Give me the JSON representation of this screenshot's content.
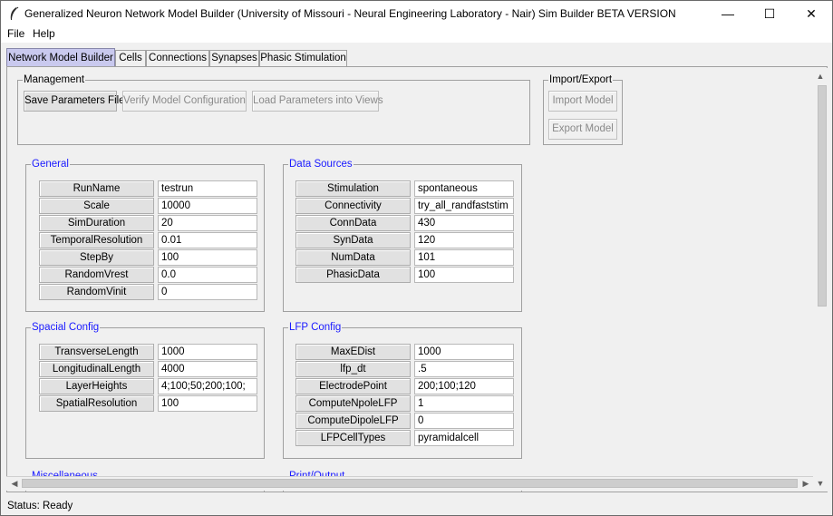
{
  "window": {
    "title": "Generalized Neuron Network Model Builder (University of Missouri - Neural Engineering Laboratory - Nair) Sim Builder BETA VERSION",
    "minimize": "—",
    "maximize": "☐",
    "close": "✕"
  },
  "menu": {
    "file": "File",
    "help": "Help"
  },
  "tabs": [
    "Network Model Builder",
    "Cells",
    "Connections",
    "Synapses",
    "Phasic Stimulation"
  ],
  "management": {
    "label": "Management",
    "save": "Save Parameters File",
    "verify": "Verify Model Configuration",
    "load": "Load Parameters into Views"
  },
  "import_export": {
    "label": "Import/Export",
    "import": "Import Model",
    "export": "Export Model"
  },
  "general": {
    "label": "General",
    "rows": [
      {
        "name": "RunName",
        "value": "testrun"
      },
      {
        "name": "Scale",
        "value": "10000"
      },
      {
        "name": "SimDuration",
        "value": "20"
      },
      {
        "name": "TemporalResolution",
        "value": "0.01"
      },
      {
        "name": "StepBy",
        "value": "100"
      },
      {
        "name": "RandomVrest",
        "value": "0.0"
      },
      {
        "name": "RandomVinit",
        "value": "0"
      }
    ]
  },
  "data_sources": {
    "label": "Data Sources",
    "rows": [
      {
        "name": "Stimulation",
        "value": "spontaneous"
      },
      {
        "name": "Connectivity",
        "value": "try_all_randfaststim"
      },
      {
        "name": "ConnData",
        "value": "430"
      },
      {
        "name": "SynData",
        "value": "120"
      },
      {
        "name": "NumData",
        "value": "101"
      },
      {
        "name": "PhasicData",
        "value": "100"
      }
    ]
  },
  "spacial": {
    "label": "Spacial Config",
    "rows": [
      {
        "name": "TransverseLength",
        "value": "1000"
      },
      {
        "name": "LongitudinalLength",
        "value": "4000"
      },
      {
        "name": "LayerHeights",
        "value": "4;100;50;200;100;"
      },
      {
        "name": "SpatialResolution",
        "value": "100"
      }
    ]
  },
  "lfp": {
    "label": "LFP Config",
    "rows": [
      {
        "name": "MaxEDist",
        "value": "1000"
      },
      {
        "name": "lfp_dt",
        "value": ".5"
      },
      {
        "name": "ElectrodePoint",
        "value": "200;100;120"
      },
      {
        "name": "ComputeNpoleLFP",
        "value": "1"
      },
      {
        "name": "ComputeDipoleLFP",
        "value": "0"
      },
      {
        "name": "LFPCellTypes",
        "value": "pyramidalcell"
      }
    ]
  },
  "misc": {
    "label": "Miscellaneous"
  },
  "print_output": {
    "label": "Print/Output"
  },
  "status": {
    "text": "Status: Ready"
  }
}
